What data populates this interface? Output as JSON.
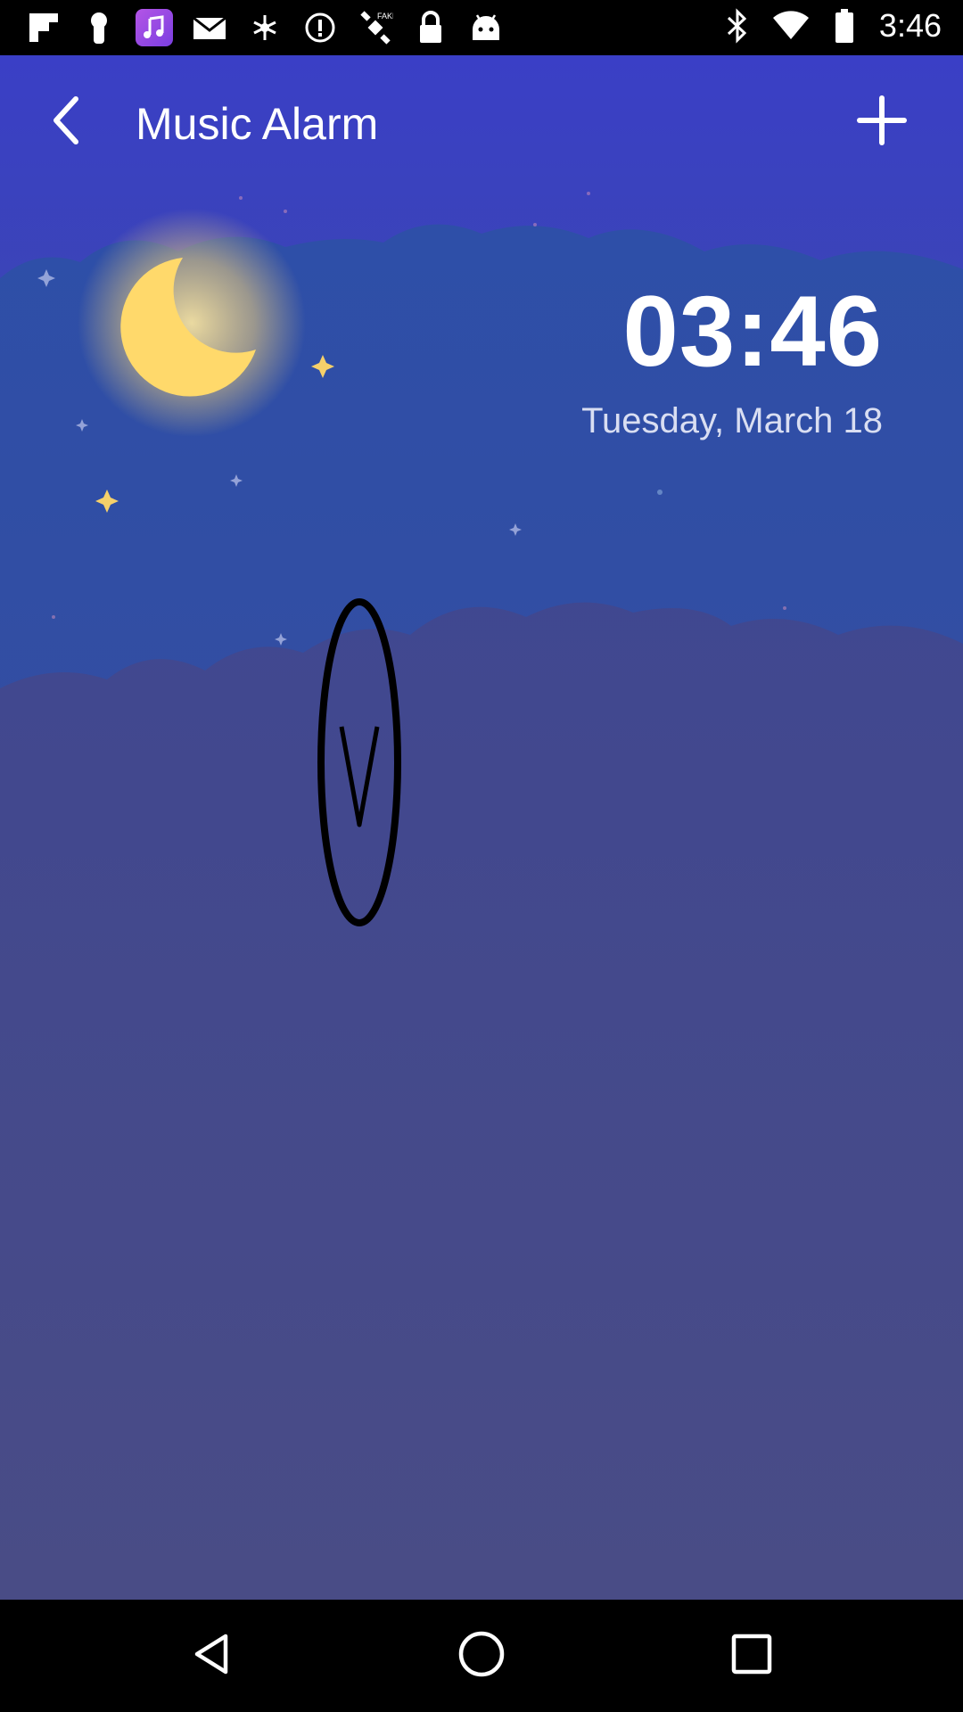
{
  "status_bar": {
    "time": "3:46",
    "left_icons": [
      "flipboard-icon",
      "keyhole-icon",
      "music-note-icon",
      "mail-icon",
      "bug-icon",
      "alert-icon",
      "satellite-icon",
      "lock-icon",
      "android-icon"
    ],
    "right_icons": [
      "bluetooth-icon",
      "wifi-icon",
      "battery-icon"
    ]
  },
  "header": {
    "title": "Music Alarm",
    "back_icon": "chevron-left-icon",
    "add_icon": "plus-icon"
  },
  "clock": {
    "time": "03:46",
    "date": "Tuesday, March 18"
  },
  "toggle": {
    "icon": "chevron-down-icon"
  },
  "nav_bar": {
    "icons": [
      "back-triangle-icon",
      "home-circle-icon",
      "recents-square-icon"
    ]
  },
  "colors": {
    "sky_top": "#3a3fc6",
    "sky_bottom": "#6f7ee6",
    "moon": "#ffd96b",
    "text": "#ffffff"
  }
}
